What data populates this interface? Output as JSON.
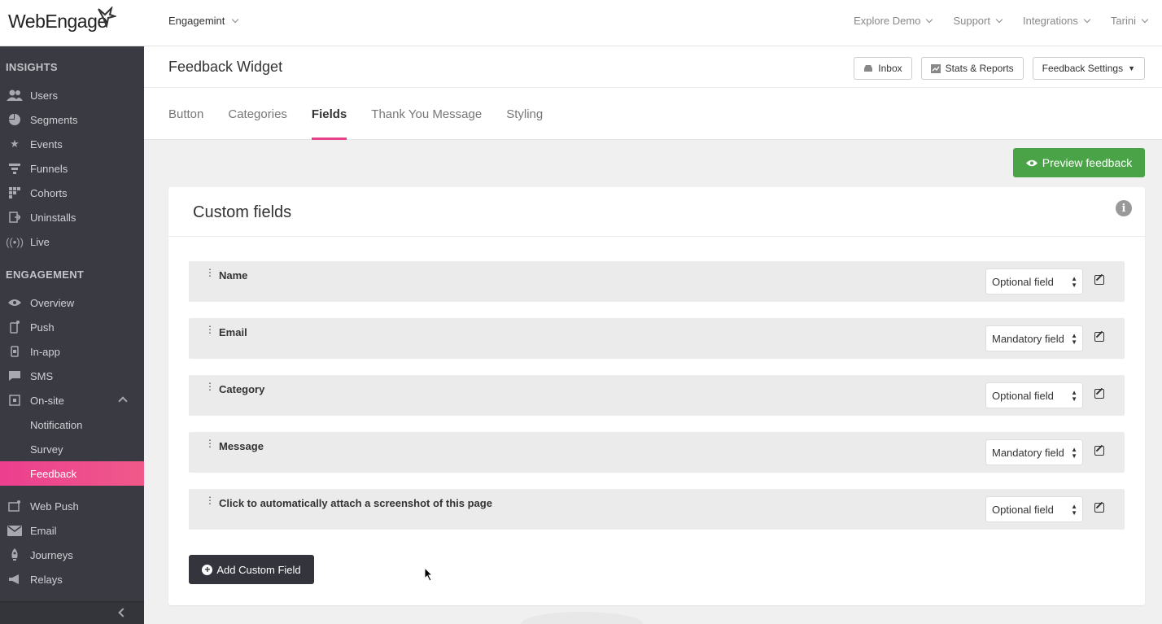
{
  "brand": {
    "logo_text": "WebEngage",
    "accent": "#e94189",
    "sidebar_bg": "#3a3a42"
  },
  "topbar": {
    "project": "Engagemint",
    "nav": [
      "Explore Demo",
      "Support",
      "Integrations",
      "Tarini"
    ]
  },
  "sidebar": {
    "sections": {
      "insights": "INSIGHTS",
      "engagement": "ENGAGEMENT"
    },
    "insights_items": [
      {
        "label": "Users",
        "icon": "users-icon"
      },
      {
        "label": "Segments",
        "icon": "pie-chart-icon"
      },
      {
        "label": "Events",
        "icon": "star-icon"
      },
      {
        "label": "Funnels",
        "icon": "funnel-icon"
      },
      {
        "label": "Cohorts",
        "icon": "grid-icon"
      },
      {
        "label": "Uninstalls",
        "icon": "uninstall-icon"
      },
      {
        "label": "Live",
        "icon": "broadcast-icon"
      }
    ],
    "engagement_items": [
      {
        "label": "Overview",
        "icon": "eye-icon"
      },
      {
        "label": "Push",
        "icon": "mobile-push-icon"
      },
      {
        "label": "In-app",
        "icon": "in-app-icon"
      },
      {
        "label": "SMS",
        "icon": "sms-icon"
      },
      {
        "label": "On-site",
        "icon": "on-site-icon"
      }
    ],
    "onsite_subitems": [
      "Notification",
      "Survey",
      "Feedback"
    ],
    "other_items": [
      {
        "label": "Web Push",
        "icon": "web-push-icon"
      },
      {
        "label": "Email",
        "icon": "email-icon"
      },
      {
        "label": "Journeys",
        "icon": "rocket-icon"
      },
      {
        "label": "Relays",
        "icon": "megaphone-icon"
      }
    ]
  },
  "header": {
    "title": "Feedback Widget",
    "buttons": {
      "inbox": "Inbox",
      "stats": "Stats & Reports",
      "settings": "Feedback Settings"
    },
    "tabs": [
      "Button",
      "Categories",
      "Fields",
      "Thank You Message",
      "Styling"
    ],
    "active_tab": "Fields"
  },
  "preview_button": "Preview feedback",
  "card": {
    "title": "Custom fields",
    "fields": [
      {
        "label": "Name",
        "requirement": "Optional field"
      },
      {
        "label": "Email",
        "requirement": "Mandatory field"
      },
      {
        "label": "Category",
        "requirement": "Optional field"
      },
      {
        "label": "Message",
        "requirement": "Mandatory field"
      },
      {
        "label": "Click to automatically attach a screenshot of this page",
        "requirement": "Optional field"
      }
    ],
    "add_button": "Add Custom Field"
  }
}
